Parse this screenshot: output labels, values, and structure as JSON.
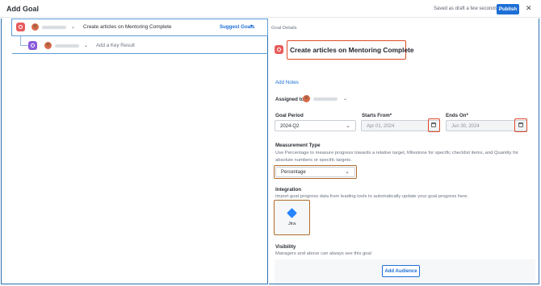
{
  "header": {
    "title": "Add Goal",
    "draft_status": "Saved as draft a few seconds ago",
    "publish_label": "Publish",
    "close_glyph": "✕"
  },
  "tree": {
    "goal_title": "Create articles on Mentoring Complete",
    "suggest_label": "Suggest Goals",
    "key_result_placeholder": "Add a Key Result"
  },
  "details": {
    "section_label": "Goal Details",
    "goal_title": "Create articles on Mentoring Complete",
    "add_notes": "Add Notes",
    "assigned_to_label": "Assigned to",
    "goal_period_label": "Goal Period",
    "goal_period_value": "2024-Q2",
    "starts_from_label": "Starts From*",
    "starts_from_value": "Apr 01, 2024",
    "ends_on_label": "Ends On*",
    "ends_on_value": "Jun 30, 2024",
    "measurement_label": "Measurement Type",
    "measurement_help_1": "Use Percentage to measure progress towards a relative target, Milestone for specific checklist items, and Quantity for",
    "measurement_help_2": "absolute numbers or specific targets.",
    "measurement_value": "Percentage",
    "integration_label": "Integration",
    "integration_help": "Import goal progress data from leading tools to automatically update your goal progress here.",
    "jira_label": "Jira",
    "visibility_label": "Visibility",
    "visibility_help": "Managers and above can always see this goal",
    "add_audience": "Add Audience"
  },
  "colors": {
    "accent": "#1d6fd6",
    "goal_icon": "#e85b5b",
    "key_result_icon": "#8a5bd9",
    "highlight_red": "#e04a2a",
    "highlight_orange": "#b06c2a",
    "jira_blue": "#2684ff"
  },
  "icons": [
    "goal-target-icon",
    "key-result-icon",
    "avatar",
    "chevron-down-icon",
    "calendar-icon",
    "jira-icon",
    "close-icon"
  ]
}
